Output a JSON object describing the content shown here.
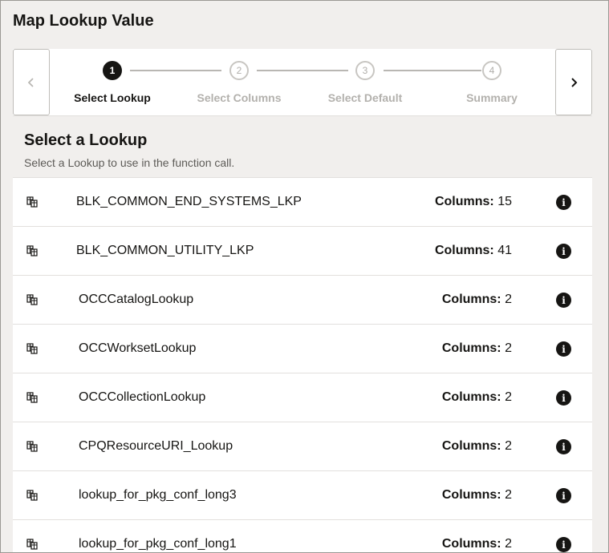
{
  "title": "Map Lookup Value",
  "train": {
    "prev_icon": "chevron-left-icon",
    "next_icon": "chevron-right-icon",
    "steps": [
      {
        "number": "1",
        "label": "Select Lookup",
        "state": "active"
      },
      {
        "number": "2",
        "label": "Select Columns",
        "state": "inactive"
      },
      {
        "number": "3",
        "label": "Select Default",
        "state": "inactive"
      },
      {
        "number": "4",
        "label": "Summary",
        "state": "inactive"
      }
    ]
  },
  "section": {
    "title": "Select a Lookup",
    "description": "Select a Lookup to use in the function call."
  },
  "columns_label": "Columns:",
  "lookups": [
    {
      "name": "BLK_COMMON_END_SYSTEMS_LKP",
      "columns": "15"
    },
    {
      "name": "BLK_COMMON_UTILITY_LKP",
      "columns": "41"
    },
    {
      "name": "OCCCatalogLookup",
      "columns": "2"
    },
    {
      "name": "OCCWorksetLookup",
      "columns": "2"
    },
    {
      "name": "OCCCollectionLookup",
      "columns": "2"
    },
    {
      "name": "CPQResourceURI_Lookup",
      "columns": "2"
    },
    {
      "name": "lookup_for_pkg_conf_long3",
      "columns": "2"
    },
    {
      "name": "lookup_for_pkg_conf_long1",
      "columns": "2"
    }
  ],
  "colors": {
    "background": "#f1efed",
    "active_step": "#161513",
    "inactive_step": "#b3b1ad"
  }
}
